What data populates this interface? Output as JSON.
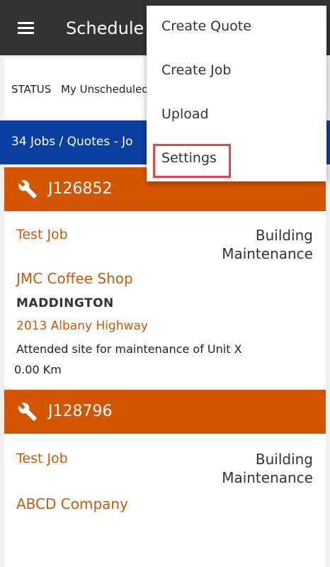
{
  "appbar": {
    "title": "Schedule"
  },
  "status": {
    "label": "STATUS",
    "value": "My Unscheduled"
  },
  "count_bar": {
    "text": "34 Jobs / Quotes - Jo"
  },
  "jobs": [
    {
      "number": "J126852",
      "title": "Test Job",
      "type_line1": "Building",
      "type_line2": "Maintenance",
      "company": "JMC Coffee Shop",
      "suburb": "MADDINGTON",
      "address": "2013 Albany Highway",
      "description": "Attended site for maintenance of Unit X",
      "distance": "0.00 Km"
    },
    {
      "number": "J128796",
      "title": "Test Job",
      "type_line1": "Building",
      "type_line2": "Maintenance",
      "company": "ABCD Company"
    }
  ],
  "menu": {
    "items": [
      {
        "label": "Create Quote"
      },
      {
        "label": "Create Job"
      },
      {
        "label": "Upload"
      },
      {
        "label": "Settings"
      }
    ]
  },
  "colors": {
    "appbar": "#333333",
    "count_bar": "#0a3fa0",
    "card_header": "#d45500",
    "accent_text": "#c85a0c",
    "highlight": "#e0474c"
  },
  "icons": [
    "menu-icon",
    "wrench-icon"
  ]
}
